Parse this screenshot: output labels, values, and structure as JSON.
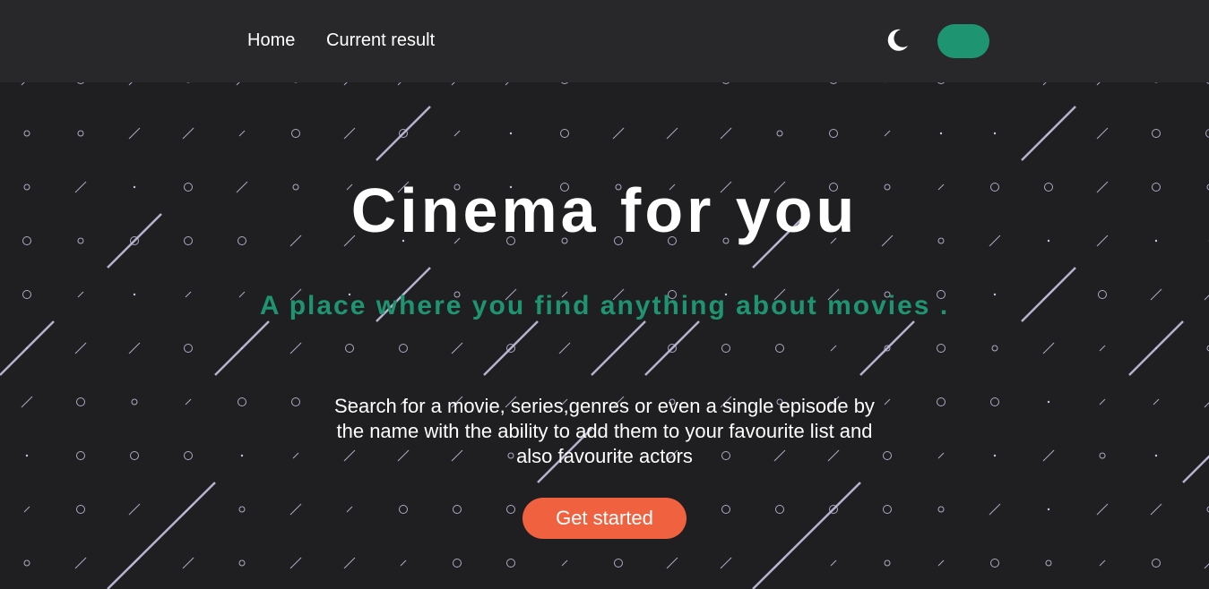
{
  "nav": {
    "links": [
      {
        "label": "Home"
      },
      {
        "label": "Current result"
      }
    ],
    "theme_icon": "moon-icon",
    "toggle_color": "#1e9470"
  },
  "hero": {
    "title": "Cinema for you",
    "subtitle": "A place where you find anything about movies .",
    "description": "Search for a movie, series,genres or even a single episode by the name with the ability to add them to your favourite list and also favourite actors",
    "cta_label": "Get started"
  },
  "colors": {
    "background": "#1f1f21",
    "navbar": "#28282b",
    "accent": "#1e9470",
    "cta": "#f0623f",
    "text": "#ffffff",
    "pattern_stroke": "#c7c3e2"
  }
}
